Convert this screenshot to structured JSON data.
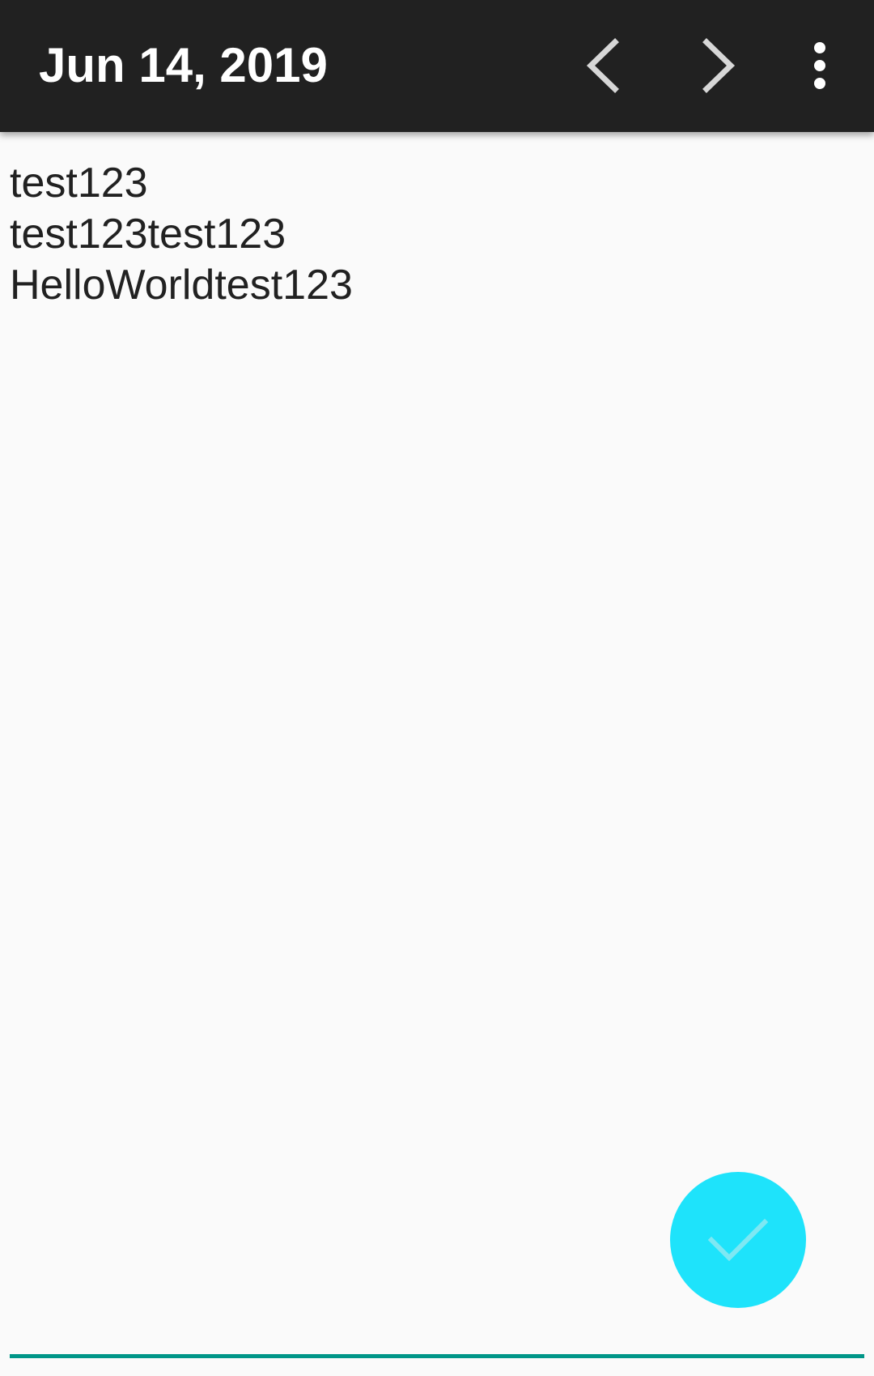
{
  "toolbar": {
    "title": "Jun 14, 2019",
    "prev_icon": "chevron-left-icon",
    "next_icon": "chevron-right-icon",
    "more_icon": "more-vert-icon"
  },
  "editor": {
    "lines": [
      "test123",
      "test123test123",
      "HelloWorldtest123"
    ]
  },
  "fab": {
    "icon": "check-icon"
  },
  "colors": {
    "toolbar_bg": "#212121",
    "fab_bg": "#1ee3fb",
    "underline": "#009688",
    "background": "#fafafa"
  }
}
